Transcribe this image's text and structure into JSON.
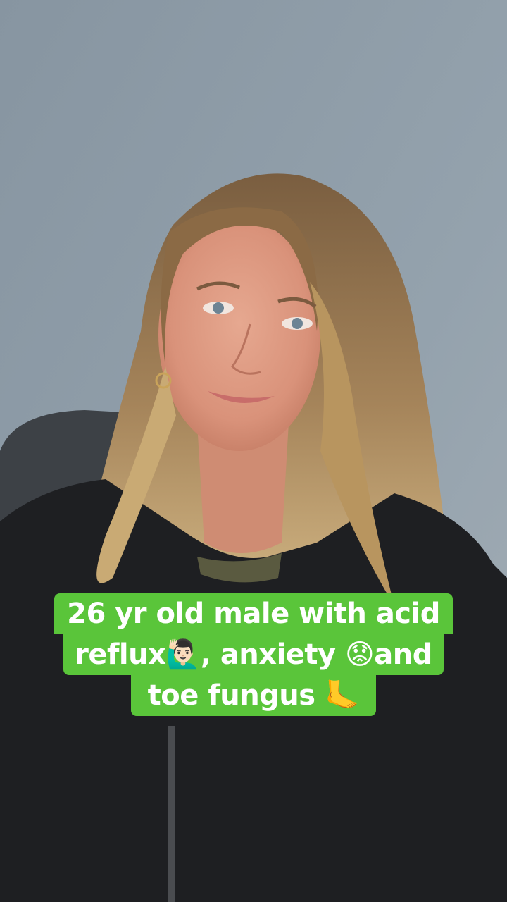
{
  "caption": {
    "line1": "26 yr old male with acid",
    "line2": "reflux🙋🏻‍♂️, anxiety 😟and",
    "line3": "toe fungus 🦶",
    "background_color": "#5ac53a",
    "text_color": "#ffffff"
  },
  "scene": {
    "background_wall_color": "#8c99a4",
    "hair_color": "#c9a874",
    "jacket_color": "#1e1f22"
  }
}
